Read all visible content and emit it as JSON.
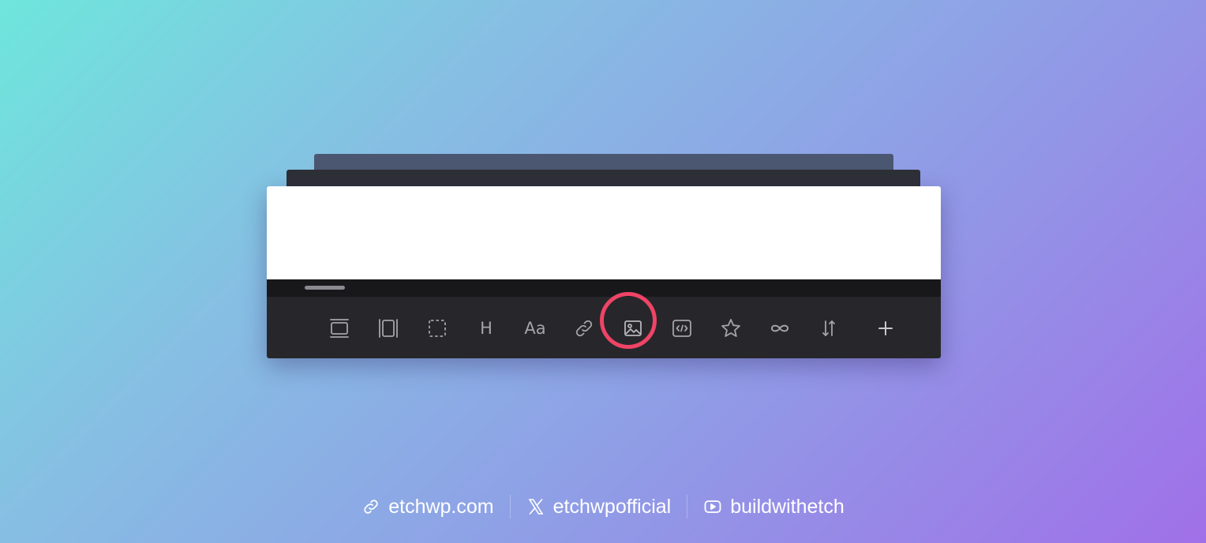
{
  "toolbar": {
    "tools": [
      {
        "id": "section",
        "icon": "section-icon"
      },
      {
        "id": "container",
        "icon": "container-icon"
      },
      {
        "id": "div",
        "icon": "dashed-box-icon"
      },
      {
        "id": "heading",
        "icon": "heading-icon",
        "label": "H"
      },
      {
        "id": "text",
        "icon": "text-icon",
        "label": "Aa"
      },
      {
        "id": "link",
        "icon": "link-icon"
      },
      {
        "id": "image",
        "icon": "image-icon",
        "highlighted": true
      },
      {
        "id": "code",
        "icon": "code-icon"
      },
      {
        "id": "component",
        "icon": "star-icon"
      },
      {
        "id": "loop",
        "icon": "infinity-icon"
      },
      {
        "id": "sort",
        "icon": "sort-icon"
      },
      {
        "id": "add",
        "icon": "plus-icon"
      }
    ]
  },
  "footer": {
    "website": "etchwp.com",
    "x_handle": "etchwpofficial",
    "youtube": "buildwithetch"
  },
  "colors": {
    "toolbar_bg": "#27272b",
    "strip_bg": "#18181b",
    "icon": "#a3a3aa",
    "highlight": "#ee4466",
    "gradient_start": "#6ee6dc",
    "gradient_end": "#a070e8"
  }
}
